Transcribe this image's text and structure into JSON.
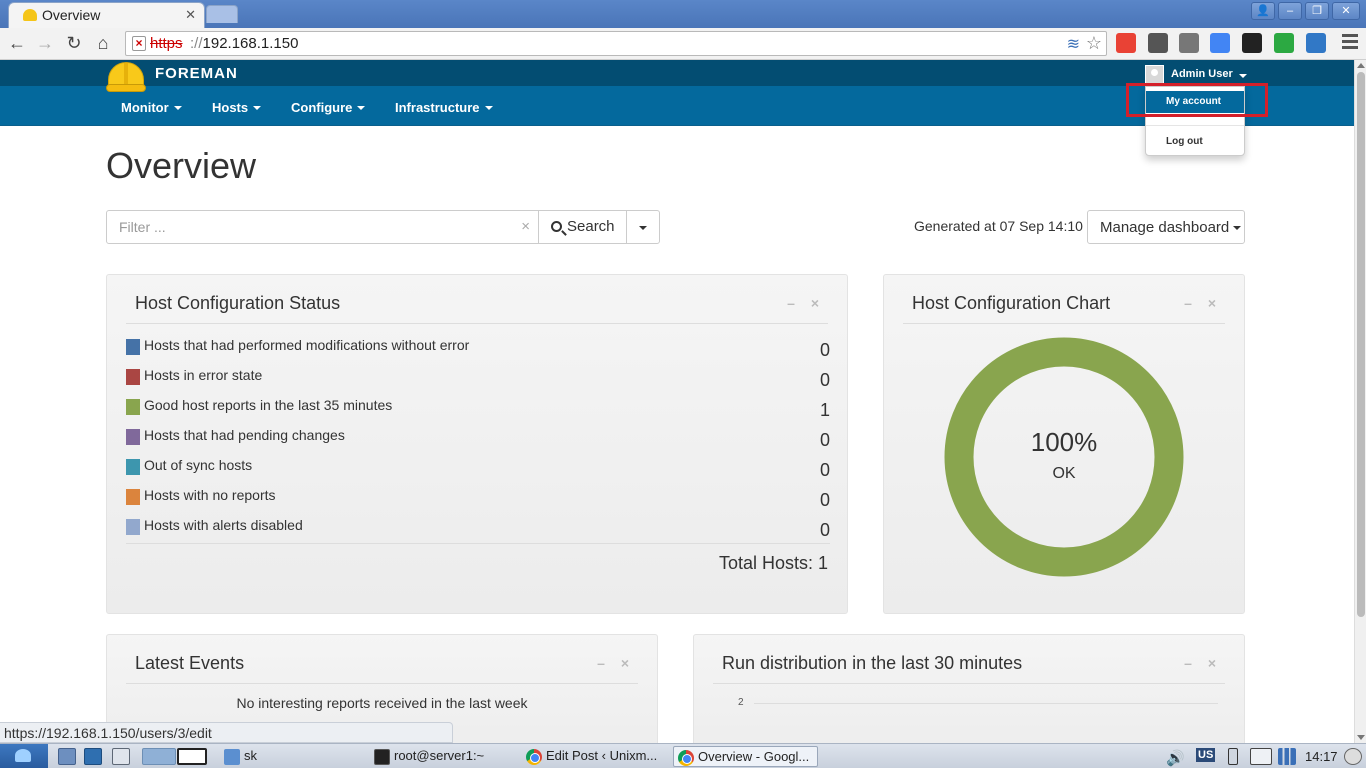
{
  "browser": {
    "tab_title": "Overview",
    "tab_close": "✕",
    "url_scheme": "https",
    "url_sep": "://",
    "url_host": "192.168.1.150",
    "window_buttons": {
      "user": "👤",
      "minimize": "–",
      "restore": "❐",
      "close": "✕"
    },
    "status_url": "https://192.168.1.150/users/3/edit"
  },
  "header": {
    "brand": "FOREMAN",
    "nav": [
      "Monitor",
      "Hosts",
      "Configure",
      "Infrastructure"
    ],
    "user_name": "Admin User",
    "user_menu": {
      "my_account": "My account",
      "log_out": "Log out"
    }
  },
  "page": {
    "title": "Overview",
    "filter_placeholder": "Filter ...",
    "filter_clear": "×",
    "search_label": "Search",
    "generated": "Generated at 07 Sep 14:10",
    "manage_dashboard": "Manage dashboard",
    "widget_controls": "– ×"
  },
  "host_status": {
    "title": "Host Configuration Status",
    "rows": [
      {
        "label": "Hosts that had performed modifications without error",
        "count": "0",
        "color": "#4572a7"
      },
      {
        "label": "Hosts in error state",
        "count": "0",
        "color": "#aa4643"
      },
      {
        "label": "Good host reports in the last 35 minutes",
        "count": "1",
        "color": "#89a54e"
      },
      {
        "label": "Hosts that had pending changes",
        "count": "0",
        "color": "#80699b"
      },
      {
        "label": "Out of sync hosts",
        "count": "0",
        "color": "#3d96ae"
      },
      {
        "label": "Hosts with no reports",
        "count": "0",
        "color": "#db843d"
      },
      {
        "label": "Hosts with alerts disabled",
        "count": "0",
        "color": "#92a8cd"
      }
    ],
    "total": "Total Hosts: 1"
  },
  "host_chart": {
    "title": "Host Configuration Chart",
    "percent": "100%",
    "label": "OK",
    "color": "#89a54e"
  },
  "latest_events": {
    "title": "Latest Events",
    "message": "No interesting reports received in the last week"
  },
  "run_distribution": {
    "title": "Run distribution in the last 30 minutes",
    "y_tick": "2"
  },
  "taskbar": {
    "folder_label": "sk",
    "tasks": [
      "root@server1:~",
      "Edit Post ‹ Unixm...",
      "Overview - Googl..."
    ],
    "keyboard_layout": "US",
    "clock": "14:17"
  }
}
